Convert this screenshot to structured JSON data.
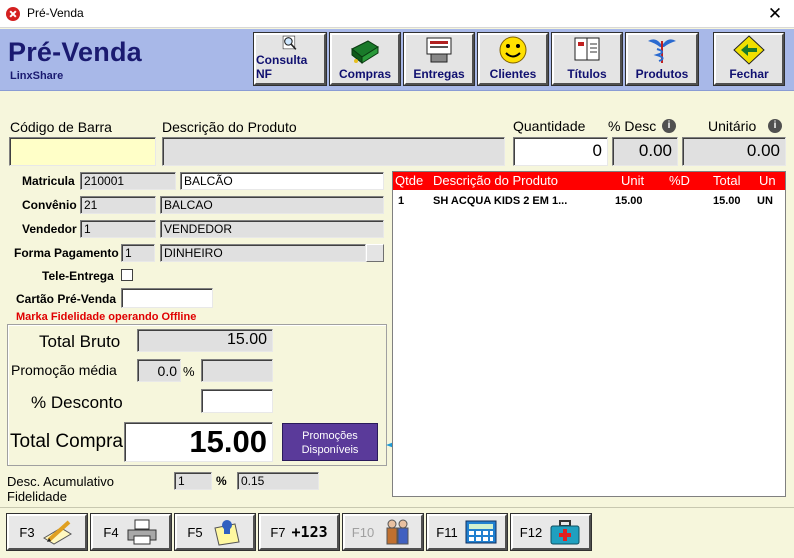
{
  "window": {
    "title": "Pré-Venda",
    "close_glyph": "✕"
  },
  "header": {
    "app_title": "Pré-Venda",
    "subtitle": "LinxShare"
  },
  "toolbar": [
    {
      "label": "Consulta NF",
      "icon": "magnifier-icon"
    },
    {
      "label": "Compras",
      "icon": "cash-register-icon"
    },
    {
      "label": "Entregas",
      "icon": "delivery-icon"
    },
    {
      "label": "Clientes",
      "icon": "smiley-icon"
    },
    {
      "label": "Títulos",
      "icon": "book-icon"
    },
    {
      "label": "Produtos",
      "icon": "caduceus-icon"
    },
    {
      "label": "Fechar",
      "icon": "exit-arrow-icon"
    }
  ],
  "product": {
    "barcode_label": "Código de Barra",
    "barcode_value": "",
    "description_label": "Descrição do Produto",
    "description_value": "",
    "quantity_label": "Quantidade",
    "quantity_value": "0",
    "discount_label": "% Desc",
    "discount_value": "0.00",
    "unit_label": "Unitário",
    "unit_value": "0.00"
  },
  "info": {
    "matricula_label": "Matricula",
    "matricula_code": "210001",
    "matricula_name": "BALCÃO",
    "convenio_label": "Convênio",
    "convenio_code": "21",
    "convenio_name": "BALCAO",
    "vendedor_label": "Vendedor",
    "vendedor_code": "1",
    "vendedor_name": "VENDEDOR",
    "pagamento_label": "Forma Pagamento",
    "pagamento_code": "1",
    "pagamento_name": "DINHEIRO",
    "tele_entrega_label": "Tele-Entrega",
    "cartao_label": "Cartão Pré-Venda",
    "cartao_value": "",
    "fidelidade_warning": "Marka Fidelidade operando Offline"
  },
  "totals": {
    "total_bruto_label": "Total Bruto",
    "total_bruto_value": "15.00",
    "promocao_label": "Promoção média",
    "promocao_value": "0.0",
    "promocao_pct": "%",
    "promocao_extra": "",
    "desconto_label": "% Desconto",
    "desconto_value": "",
    "total_compra_label": "Total Compra",
    "total_compra_value": "15.00",
    "promo_button_line1": "Promoções",
    "promo_button_line2": "Disponíveis"
  },
  "acumulativo": {
    "label_line1": "Desc. Acumulativo",
    "label_line2": "Fidelidade",
    "value1": "1",
    "pct": "%",
    "value2": "0.15"
  },
  "grid": {
    "columns": [
      "Qtde",
      "Descrição do Produto",
      "Unit",
      "%D",
      "Total",
      "Un"
    ],
    "rows": [
      {
        "qtde": "1",
        "descricao": "SH ACQUA KIDS 2 EM 1...",
        "unit": "15.00",
        "pct": "",
        "total": "15.00",
        "un": "UN"
      }
    ]
  },
  "function_keys": [
    {
      "label": "F3",
      "icon": "pencil-paper-icon",
      "enabled": true
    },
    {
      "label": "F4",
      "icon": "printer-icon",
      "enabled": true
    },
    {
      "label": "F5",
      "icon": "notes-icon",
      "enabled": true
    },
    {
      "label": "F7",
      "icon": "numbering-icon",
      "text": "+123",
      "enabled": true
    },
    {
      "label": "F10",
      "icon": "people-icon",
      "enabled": false
    },
    {
      "label": "F11",
      "icon": "calculator-icon",
      "enabled": true
    },
    {
      "label": "F12",
      "icon": "first-aid-kit-icon",
      "enabled": true
    }
  ],
  "colors": {
    "header_bg": "#a8b8e8",
    "grid_header": "#ff0000",
    "promo_button": "#5a3a9a",
    "arrow": "#1e9ad6",
    "warning": "#e00000"
  }
}
